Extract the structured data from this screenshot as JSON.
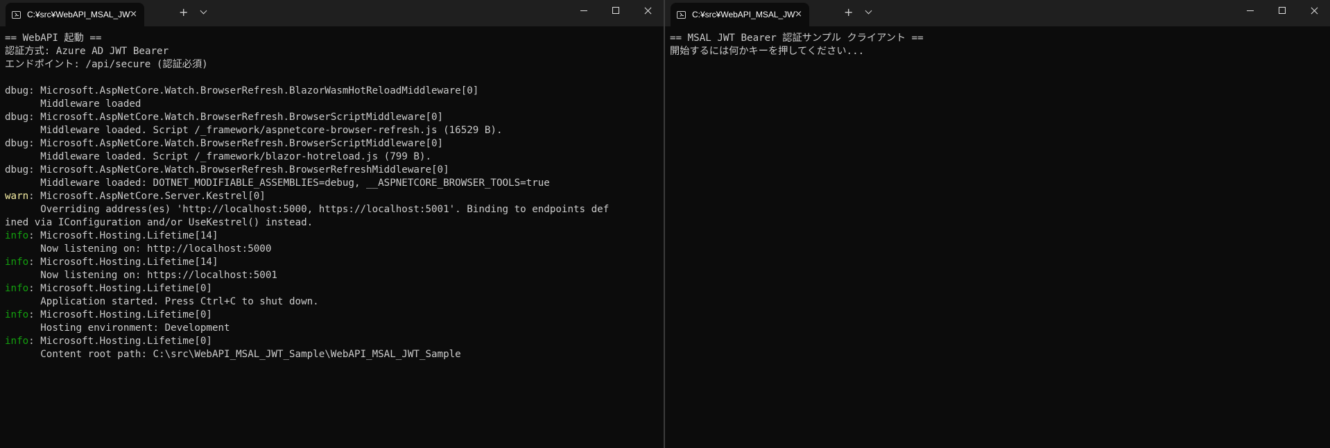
{
  "left_window": {
    "tab": {
      "title": "C:¥src¥WebAPI_MSAL_JWT_Sample"
    },
    "console_lines": [
      {
        "level": "",
        "text": "== WebAPI 起動 =="
      },
      {
        "level": "",
        "text": "認証方式: Azure AD JWT Bearer"
      },
      {
        "level": "",
        "text": "エンドポイント: /api/secure (認証必須)"
      },
      {
        "level": "",
        "text": ""
      },
      {
        "level": "dbug",
        "text": ": Microsoft.AspNetCore.Watch.BrowserRefresh.BlazorWasmHotReloadMiddleware[0]"
      },
      {
        "level": "",
        "text": "      Middleware loaded"
      },
      {
        "level": "dbug",
        "text": ": Microsoft.AspNetCore.Watch.BrowserRefresh.BrowserScriptMiddleware[0]"
      },
      {
        "level": "",
        "text": "      Middleware loaded. Script /_framework/aspnetcore-browser-refresh.js (16529 B)."
      },
      {
        "level": "dbug",
        "text": ": Microsoft.AspNetCore.Watch.BrowserRefresh.BrowserScriptMiddleware[0]"
      },
      {
        "level": "",
        "text": "      Middleware loaded. Script /_framework/blazor-hotreload.js (799 B)."
      },
      {
        "level": "dbug",
        "text": ": Microsoft.AspNetCore.Watch.BrowserRefresh.BrowserRefreshMiddleware[0]"
      },
      {
        "level": "",
        "text": "      Middleware loaded: DOTNET_MODIFIABLE_ASSEMBLIES=debug, __ASPNETCORE_BROWSER_TOOLS=true"
      },
      {
        "level": "warn",
        "text": ": Microsoft.AspNetCore.Server.Kestrel[0]"
      },
      {
        "level": "",
        "text": "      Overriding address(es) 'http://localhost:5000, https://localhost:5001'. Binding to endpoints def"
      },
      {
        "level": "",
        "text": "ined via IConfiguration and/or UseKestrel() instead."
      },
      {
        "level": "info",
        "text": ": Microsoft.Hosting.Lifetime[14]"
      },
      {
        "level": "",
        "text": "      Now listening on: http://localhost:5000"
      },
      {
        "level": "info",
        "text": ": Microsoft.Hosting.Lifetime[14]"
      },
      {
        "level": "",
        "text": "      Now listening on: https://localhost:5001"
      },
      {
        "level": "info",
        "text": ": Microsoft.Hosting.Lifetime[0]"
      },
      {
        "level": "",
        "text": "      Application started. Press Ctrl+C to shut down."
      },
      {
        "level": "info",
        "text": ": Microsoft.Hosting.Lifetime[0]"
      },
      {
        "level": "",
        "text": "      Hosting environment: Development"
      },
      {
        "level": "info",
        "text": ": Microsoft.Hosting.Lifetime[0]"
      },
      {
        "level": "",
        "text": "      Content root path: C:\\src\\WebAPI_MSAL_JWT_Sample\\WebAPI_MSAL_JWT_Sample"
      }
    ]
  },
  "right_window": {
    "tab": {
      "title": "C:¥src¥WebAPI_MSAL_JWT_Sample"
    },
    "console_lines": [
      {
        "level": "",
        "text": "== MSAL JWT Bearer 認証サンプル クライアント =="
      },
      {
        "level": "",
        "text": "開始するには何かキーを押してください..."
      }
    ]
  },
  "icons": {
    "tab_icon": "terminal-icon",
    "close": "×",
    "new_tab": "+",
    "dropdown": "chevron-down-icon",
    "minimize": "minimize-icon",
    "maximize": "maximize-icon",
    "window_close": "close-icon"
  },
  "colors": {
    "background": "#0c0c0c",
    "titlebar": "#1f1f1f",
    "text": "#cccccc",
    "info": "#13a10e",
    "warn": "#f9f1a5"
  }
}
